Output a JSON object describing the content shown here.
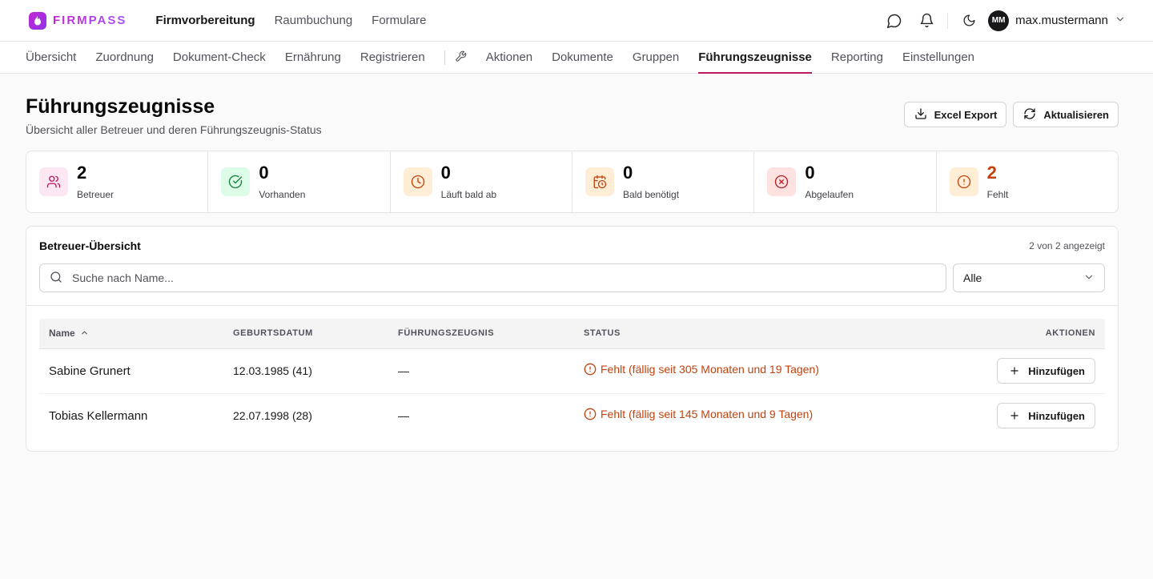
{
  "brand": {
    "name": "FIRMPASS"
  },
  "main_nav": [
    {
      "label": "Firmvorbereitung",
      "active": true
    },
    {
      "label": "Raumbuchung",
      "active": false
    },
    {
      "label": "Formulare",
      "active": false
    }
  ],
  "user": {
    "initials": "MM",
    "name": "max.mustermann"
  },
  "sub_nav": {
    "left": [
      "Übersicht",
      "Zuordnung",
      "Dokument-Check",
      "Ernährung",
      "Registrieren"
    ],
    "right": [
      "Aktionen",
      "Dokumente",
      "Gruppen",
      "Führungszeugnisse",
      "Reporting",
      "Einstellungen"
    ],
    "active": "Führungszeugnisse"
  },
  "page": {
    "title": "Führungszeugnisse",
    "subtitle": "Übersicht aller Betreuer und deren Führungszeugnis-Status",
    "export_label": "Excel Export",
    "refresh_label": "Aktualisieren"
  },
  "stats": [
    {
      "value": "2",
      "label": "Betreuer",
      "icon": "users-icon",
      "bg": "#fce7f3",
      "fg": "#be185d",
      "value_color": "#09090b"
    },
    {
      "value": "0",
      "label": "Vorhanden",
      "icon": "check-circle-icon",
      "bg": "#dcfce7",
      "fg": "#15803d",
      "value_color": "#09090b"
    },
    {
      "value": "0",
      "label": "Läuft bald ab",
      "icon": "clock-icon",
      "bg": "#ffedd5",
      "fg": "#c2410c",
      "value_color": "#09090b"
    },
    {
      "value": "0",
      "label": "Bald benötigt",
      "icon": "calendar-clock-icon",
      "bg": "#ffedd5",
      "fg": "#c2410c",
      "value_color": "#09090b"
    },
    {
      "value": "0",
      "label": "Abgelaufen",
      "icon": "x-circle-icon",
      "bg": "#fee2e2",
      "fg": "#b91c1c",
      "value_color": "#09090b"
    },
    {
      "value": "2",
      "label": "Fehlt",
      "icon": "alert-circle-icon",
      "bg": "#ffedd5",
      "fg": "#c2410c",
      "value_color": "#c2410c"
    }
  ],
  "overview": {
    "title": "Betreuer-Übersicht",
    "count_text": "2 von 2 angezeigt",
    "search_placeholder": "Suche nach Name...",
    "filter_value": "Alle"
  },
  "table": {
    "columns": {
      "name": "Name",
      "birth": "GEBURTSDATUM",
      "cert": "FÜHRUNGSZEUGNIS",
      "status": "STATUS",
      "actions": "AKTIONEN"
    },
    "rows": [
      {
        "name": "Sabine Grunert",
        "birth": "12.03.1985 (41)",
        "cert": "—",
        "status": "Fehlt (fällig seit 305 Monaten und 19 Tagen)",
        "action": "Hinzufügen"
      },
      {
        "name": "Tobias Kellermann",
        "birth": "22.07.1998 (28)",
        "cert": "—",
        "status": "Fehlt (fällig seit 145 Monaten und 9 Tagen)",
        "action": "Hinzufügen"
      }
    ]
  },
  "colors": {
    "accent": "#be185d",
    "warning": "#c2410c",
    "brand_start": "#c026d3",
    "brand_end": "#a855f7"
  }
}
